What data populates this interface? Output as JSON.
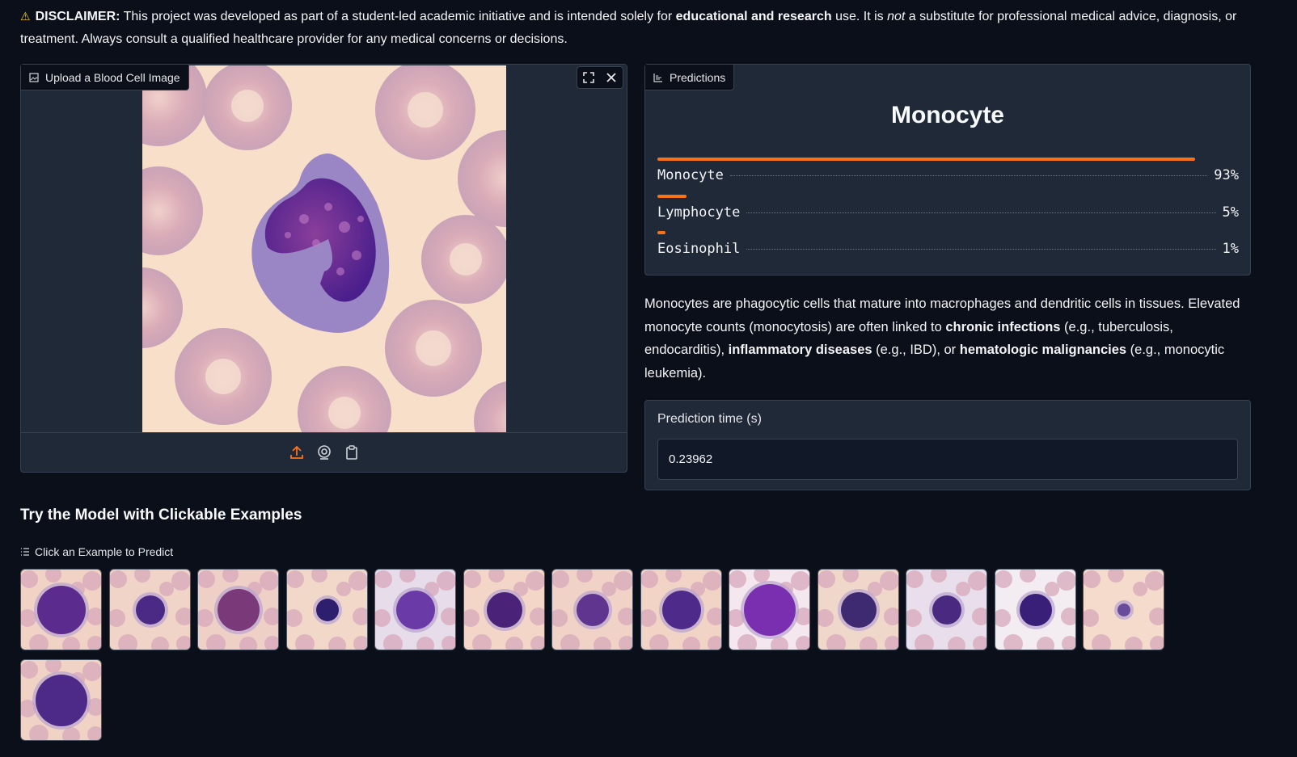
{
  "disclaimer": {
    "icon": "warning-icon",
    "label": "DISCLAIMER:",
    "t1": " This project was developed as part of a student-led academic initiative and is intended solely for ",
    "b1": "educational and research",
    "t2": " use. It is ",
    "em": "not",
    "t3": " a substitute for professional medical advice, diagnosis, or treatment. Always consult a qualified healthcare provider for any medical concerns or decisions."
  },
  "image_input": {
    "label": "Upload a Blood Cell Image",
    "icons": [
      "image-icon",
      "fullscreen-icon",
      "close-icon",
      "upload-icon",
      "webcam-icon",
      "clipboard-icon"
    ]
  },
  "predictions": {
    "label": "Predictions",
    "top_label": "Monocyte",
    "items": [
      {
        "name": "Monocyte",
        "pct": "93%",
        "value": 0.93
      },
      {
        "name": "Lymphocyte",
        "pct": "5%",
        "value": 0.05
      },
      {
        "name": "Eosinophil",
        "pct": "1%",
        "value": 0.01
      }
    ]
  },
  "description": {
    "t1": "Monocytes are phagocytic cells that mature into macrophages and dendritic cells in tissues. Elevated monocyte counts (monocytosis) are often linked to ",
    "b1": "chronic infections",
    "t2": " (e.g., tuberculosis, endocarditis), ",
    "b2": "inflammatory diseases",
    "t3": " (e.g., IBD), or ",
    "b3": "hematologic malignancies",
    "t4": " (e.g., monocytic leukemia)."
  },
  "prediction_time": {
    "label": "Prediction time (s)",
    "value": "0.23962"
  },
  "examples": {
    "heading": "Try the Model with Clickable Examples",
    "label": "Click an Example to Predict",
    "count": 14
  },
  "colors": {
    "accent": "#f97316",
    "background": "#0b0f19",
    "panel": "#1f2937"
  }
}
